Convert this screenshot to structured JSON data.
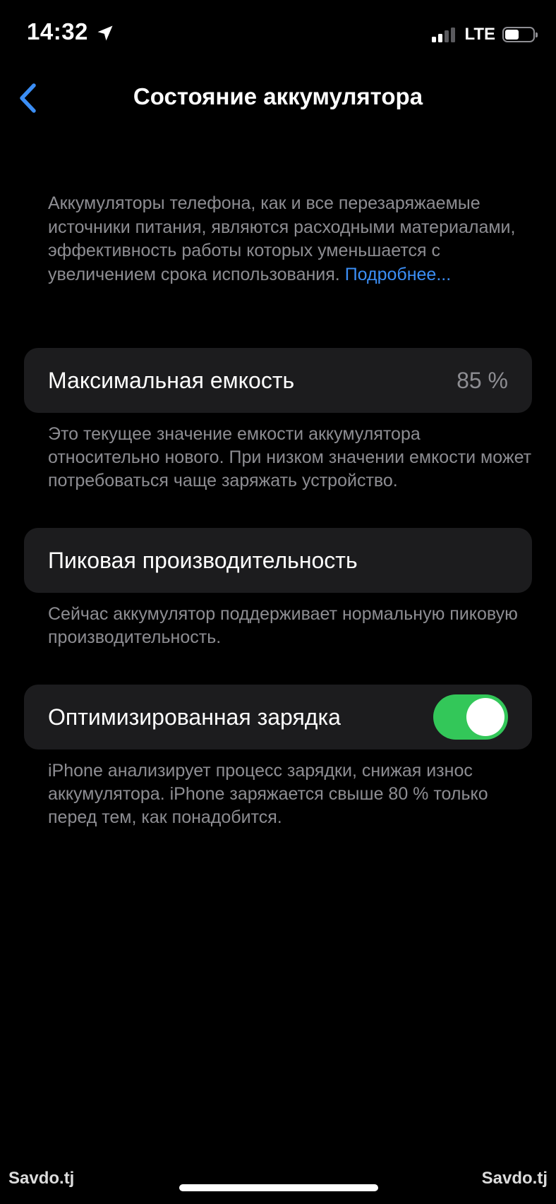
{
  "status_bar": {
    "time": "14:32",
    "network": "LTE",
    "signal_active_bars": 2,
    "signal_total_bars": 4,
    "battery_level": 0.5
  },
  "nav": {
    "title": "Состояние аккумулятора",
    "back_icon": "chevron-left-icon"
  },
  "intro": {
    "text": "Аккумуляторы телефона, как и все перезаряжаемые источники питания, являются расходными материалами, эффективность работы которых уменьшается с увеличением срока использования.",
    "link": "Подробнее..."
  },
  "max_capacity": {
    "label": "Максимальная емкость",
    "value": "85 %",
    "footer": "Это текущее значение емкости аккумулятора относительно нового. При низком значении емкости может потребоваться чаще заряжать устройство."
  },
  "peak_performance": {
    "label": "Пиковая производительность",
    "footer": "Сейчас аккумулятор поддерживает нормальную пиковую производительность."
  },
  "optimized_charging": {
    "label": "Оптимизированная зарядка",
    "enabled": true,
    "footer": "iPhone анализирует процесс зарядки, снижая износ аккумулятора. iPhone заряжается свыше 80 % только перед тем, как понадобится."
  },
  "watermarks": {
    "left": "Savdo.tj",
    "right": "Savdo.tj"
  },
  "colors": {
    "background": "#000000",
    "cell": "#1c1c1e",
    "secondary_text": "#8d8d92",
    "link": "#3b8ef5",
    "toggle_on": "#33c759",
    "signal_inactive": "#5a5a5e"
  }
}
